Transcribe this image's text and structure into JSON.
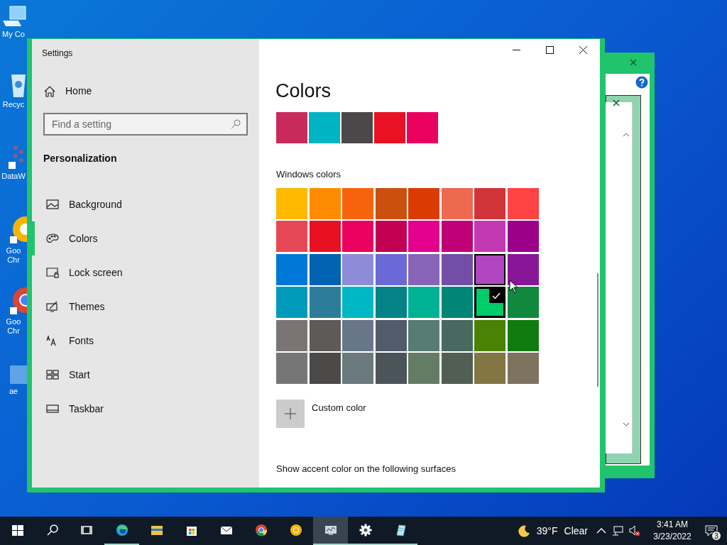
{
  "desktop_icons": [
    {
      "label": "My Co"
    },
    {
      "label": "Recyc"
    },
    {
      "label": "DataW"
    },
    {
      "label": "Goo\nChr"
    },
    {
      "label": "Goo\nChr"
    },
    {
      "label": "ae"
    }
  ],
  "window": {
    "title": "Settings"
  },
  "sidebar": {
    "home": "Home",
    "search": {
      "placeholder": "Find a setting"
    },
    "section": "Personalization",
    "items": [
      {
        "label": "Background",
        "selected": false
      },
      {
        "label": "Colors",
        "selected": true
      },
      {
        "label": "Lock screen",
        "selected": false
      },
      {
        "label": "Themes",
        "selected": false
      },
      {
        "label": "Fonts",
        "selected": false
      },
      {
        "label": "Start",
        "selected": false
      },
      {
        "label": "Taskbar",
        "selected": false
      }
    ]
  },
  "content": {
    "title": "Colors",
    "recent_colors": [
      {
        "color": "#c92a5d"
      },
      {
        "color": "#00b4c4"
      },
      {
        "color": "#4a4848"
      },
      {
        "color": "#e81224"
      },
      {
        "color": "#ea005e"
      }
    ],
    "windows_colors_label": "Windows colors",
    "windows_colors": [
      {
        "color": "#ffb900",
        "selected": false,
        "hovered": false
      },
      {
        "color": "#ff8c00",
        "selected": false,
        "hovered": false
      },
      {
        "color": "#f7630c",
        "selected": false,
        "hovered": false
      },
      {
        "color": "#ca5010",
        "selected": false,
        "hovered": false
      },
      {
        "color": "#da3b01",
        "selected": false,
        "hovered": false
      },
      {
        "color": "#ef6950",
        "selected": false,
        "hovered": false
      },
      {
        "color": "#d13438",
        "selected": false,
        "hovered": false
      },
      {
        "color": "#ff4343",
        "selected": false,
        "hovered": false
      },
      {
        "color": "#e74856",
        "selected": false,
        "hovered": false
      },
      {
        "color": "#e81123",
        "selected": false,
        "hovered": false
      },
      {
        "color": "#ea005e",
        "selected": false,
        "hovered": false
      },
      {
        "color": "#c30052",
        "selected": false,
        "hovered": false
      },
      {
        "color": "#e3008c",
        "selected": false,
        "hovered": false
      },
      {
        "color": "#bf0077",
        "selected": false,
        "hovered": false
      },
      {
        "color": "#c239b3",
        "selected": false,
        "hovered": false
      },
      {
        "color": "#9a0089",
        "selected": false,
        "hovered": false
      },
      {
        "color": "#0078d7",
        "selected": false,
        "hovered": false
      },
      {
        "color": "#0063b1",
        "selected": false,
        "hovered": false
      },
      {
        "color": "#8e8cd8",
        "selected": false,
        "hovered": false
      },
      {
        "color": "#6b69d6",
        "selected": false,
        "hovered": false
      },
      {
        "color": "#8764b8",
        "selected": false,
        "hovered": false
      },
      {
        "color": "#744da9",
        "selected": false,
        "hovered": false
      },
      {
        "color": "#b146c2",
        "selected": false,
        "hovered": true
      },
      {
        "color": "#881798",
        "selected": false,
        "hovered": false
      },
      {
        "color": "#0099bc",
        "selected": false,
        "hovered": false
      },
      {
        "color": "#2d7d9a",
        "selected": false,
        "hovered": false
      },
      {
        "color": "#00b7c3",
        "selected": false,
        "hovered": false
      },
      {
        "color": "#038387",
        "selected": false,
        "hovered": false
      },
      {
        "color": "#00b294",
        "selected": false,
        "hovered": false
      },
      {
        "color": "#018574",
        "selected": false,
        "hovered": false
      },
      {
        "color": "#00cc6a",
        "selected": true,
        "hovered": false
      },
      {
        "color": "#10893e",
        "selected": false,
        "hovered": false
      },
      {
        "color": "#7a7574",
        "selected": false,
        "hovered": false
      },
      {
        "color": "#5d5a58",
        "selected": false,
        "hovered": false
      },
      {
        "color": "#68768a",
        "selected": false,
        "hovered": false
      },
      {
        "color": "#515c6b",
        "selected": false,
        "hovered": false
      },
      {
        "color": "#567c73",
        "selected": false,
        "hovered": false
      },
      {
        "color": "#486860",
        "selected": false,
        "hovered": false
      },
      {
        "color": "#498205",
        "selected": false,
        "hovered": false
      },
      {
        "color": "#107c10",
        "selected": false,
        "hovered": false
      },
      {
        "color": "#767676",
        "selected": false,
        "hovered": false
      },
      {
        "color": "#4c4a48",
        "selected": false,
        "hovered": false
      },
      {
        "color": "#69797e",
        "selected": false,
        "hovered": false
      },
      {
        "color": "#4a5459",
        "selected": false,
        "hovered": false
      },
      {
        "color": "#647c64",
        "selected": false,
        "hovered": false
      },
      {
        "color": "#525e54",
        "selected": false,
        "hovered": false
      },
      {
        "color": "#847545",
        "selected": false,
        "hovered": false
      },
      {
        "color": "#7e735f",
        "selected": false,
        "hovered": false
      }
    ],
    "custom_color": "Custom color",
    "accent_surfaces_label": "Show accent color on the following surfaces"
  },
  "taskbar": {
    "apps": [
      {
        "running": false,
        "selected": false
      },
      {
        "running": false,
        "selected": false
      },
      {
        "running": false,
        "selected": false
      },
      {
        "running": true,
        "selected": false
      },
      {
        "running": false,
        "selected": false
      },
      {
        "running": false,
        "selected": false
      },
      {
        "running": false,
        "selected": false
      },
      {
        "running": false,
        "selected": false
      },
      {
        "running": false,
        "selected": false
      },
      {
        "running": true,
        "selected": true
      },
      {
        "running": true,
        "selected": false
      }
    ],
    "weather_temp": "39°F",
    "weather_text": "Clear",
    "time": "3:41 AM",
    "date": "3/23/2022",
    "notifications": "3"
  }
}
